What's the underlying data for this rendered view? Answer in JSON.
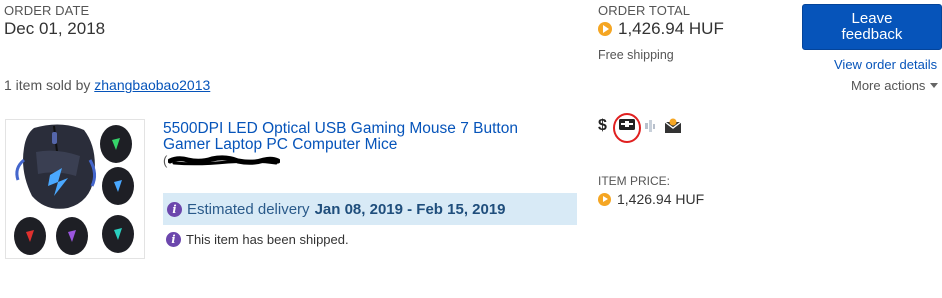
{
  "order": {
    "date_label": "ORDER DATE",
    "date_value": "Dec 01, 2018",
    "total_label": "ORDER TOTAL",
    "total_value": "1,426.94 HUF",
    "shipping_note": "Free shipping"
  },
  "actions": {
    "leave_feedback_line1": "Leave",
    "leave_feedback_line2": "feedback",
    "view_details": "View order details",
    "more_actions": "More actions"
  },
  "seller": {
    "prefix": "1 item sold by",
    "name": "zhangbaobao2013"
  },
  "item": {
    "title_line1": "5500DPI LED Optical USB Gaming Mouse 7 Button",
    "title_line2": "Gamer Laptop PC Computer Mice",
    "variant_paren": "(",
    "delivery_prefix": "Estimated delivery",
    "delivery_dates": "Jan 08, 2019 - Feb 15, 2019",
    "shipped_text": "This item has been shipped.",
    "price_label": "ITEM PRICE:",
    "price_value": "1,426.94 HUF",
    "dollar_symbol": "$"
  },
  "colors": {
    "link": "#0654ba",
    "primary_button": "#0654ba",
    "delivery_bg": "#d8eaf6",
    "info_icon": "#6c47ad",
    "huf_coin": "#f5a623",
    "annotation_circle": "#e02020"
  },
  "icons": {
    "huf_coin": "play-coin-icon",
    "status_icons": [
      "dollar-icon",
      "package-icon",
      "tracking-icon",
      "envelope-icon"
    ],
    "info": "info-icon"
  }
}
